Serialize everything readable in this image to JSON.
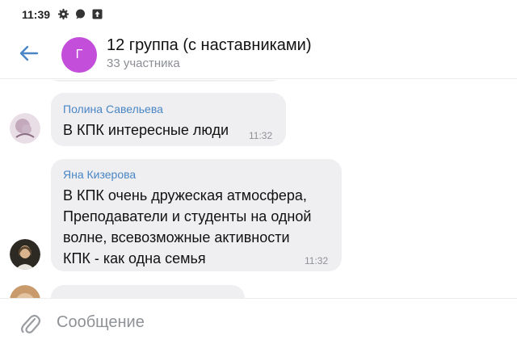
{
  "status_bar": {
    "time": "11:39",
    "icons": [
      "gear-icon",
      "message-icon",
      "upload-icon"
    ]
  },
  "header": {
    "back_icon": "arrow-left-icon",
    "avatar_letter": "Г",
    "avatar_color": "#c34ed9",
    "title": "12 группа (с наставниками)",
    "subtitle": "33 участника"
  },
  "messages": [
    {
      "sender": "Полина Савельева",
      "text": "В КПК интересные люди",
      "time": "11:32"
    },
    {
      "sender": "Яна Кизерова",
      "lines": [
        "В КПК очень дружеская атмосфера,",
        "Преподаватели и студенты на одной",
        "волне, всевозможные активности",
        "КПК - как одна семья"
      ],
      "time": "11:32"
    }
  ],
  "composer": {
    "attach_icon": "paperclip-icon",
    "placeholder": "Сообщение"
  },
  "colors": {
    "accent": "#4a86c5",
    "bubble": "#efeff1",
    "meta_text": "#8e9196"
  }
}
